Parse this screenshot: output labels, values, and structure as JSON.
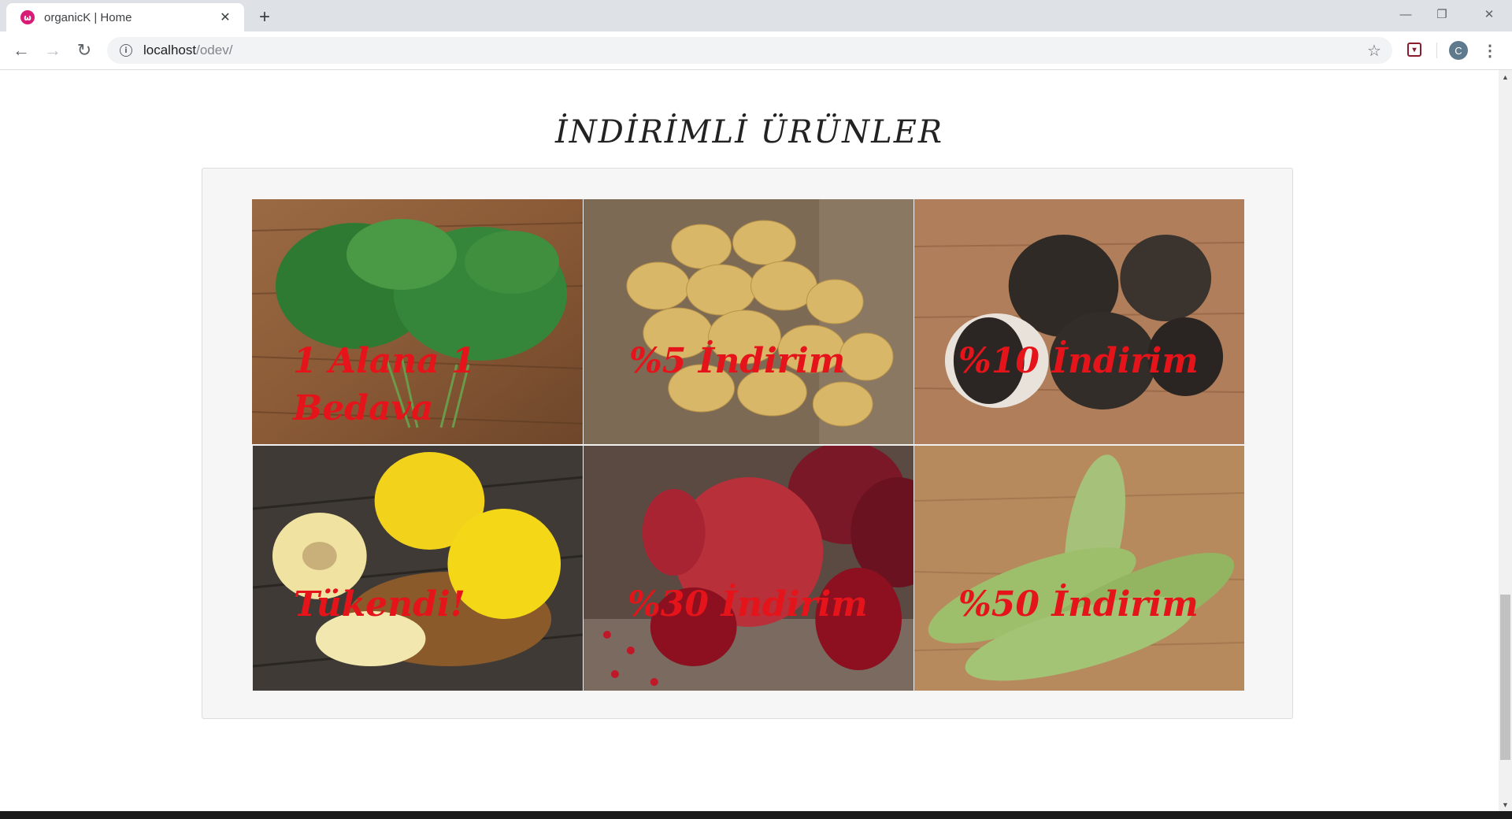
{
  "browser": {
    "tab_title": "organicK | Home",
    "favicon_letter": "ω",
    "url_host": "localhost",
    "url_path": "/odev/",
    "profile_initial": "C"
  },
  "page": {
    "title": "İNDİRİMLİ ÜRÜNLER"
  },
  "products": [
    {
      "label": "1 Alana 1 Bedava",
      "subject": "dill bunches on wood"
    },
    {
      "label": "%5 İndirim",
      "subject": "potatoes on burlap"
    },
    {
      "label": "%10 İndirim",
      "subject": "black radishes on wood"
    },
    {
      "label": "Tükendi!",
      "subject": "quinces in basket"
    },
    {
      "label": "%30 İndirim",
      "subject": "pomegranates on wood"
    },
    {
      "label": "%50 İndirim",
      "subject": "zucchini on wood"
    }
  ],
  "colors": {
    "label_red": "#e5141a",
    "panel_bg": "#f6f6f6"
  }
}
